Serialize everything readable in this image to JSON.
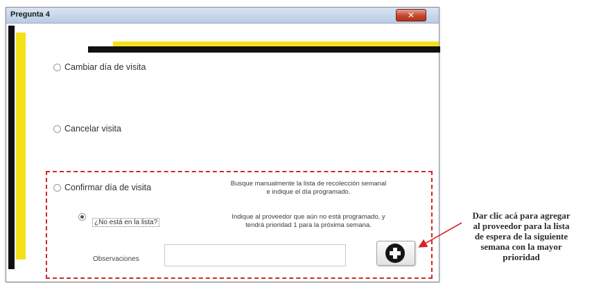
{
  "window": {
    "title": "Pregunta 4",
    "close_label": "✕"
  },
  "options": {
    "cambiar": "Cambiar día de visita",
    "cancelar": "Cancelar visita",
    "confirmar": "Confirmar día de visita"
  },
  "confirm_desc": {
    "line1": "Busque manualmente la lista de recolección semanal",
    "line2": "e indique el día programado."
  },
  "no_esta": {
    "label": "¿No está en la lista?",
    "desc_line1": "Indique al proveedor que aún no está programado, y",
    "desc_line2": "tendrá prioridad 1 para la próxima semana."
  },
  "observaciones": {
    "label": "Observaciones",
    "value": ""
  },
  "annotation": {
    "line1": "Dar clic acá para agregar",
    "line2": "al proveedor para la lista",
    "line3": "de espera de la siguiente",
    "line4": "semana con la mayor",
    "line5": "prioridad"
  },
  "colors": {
    "accent_yellow": "#f4e11a",
    "highlight_red": "#d42424"
  }
}
